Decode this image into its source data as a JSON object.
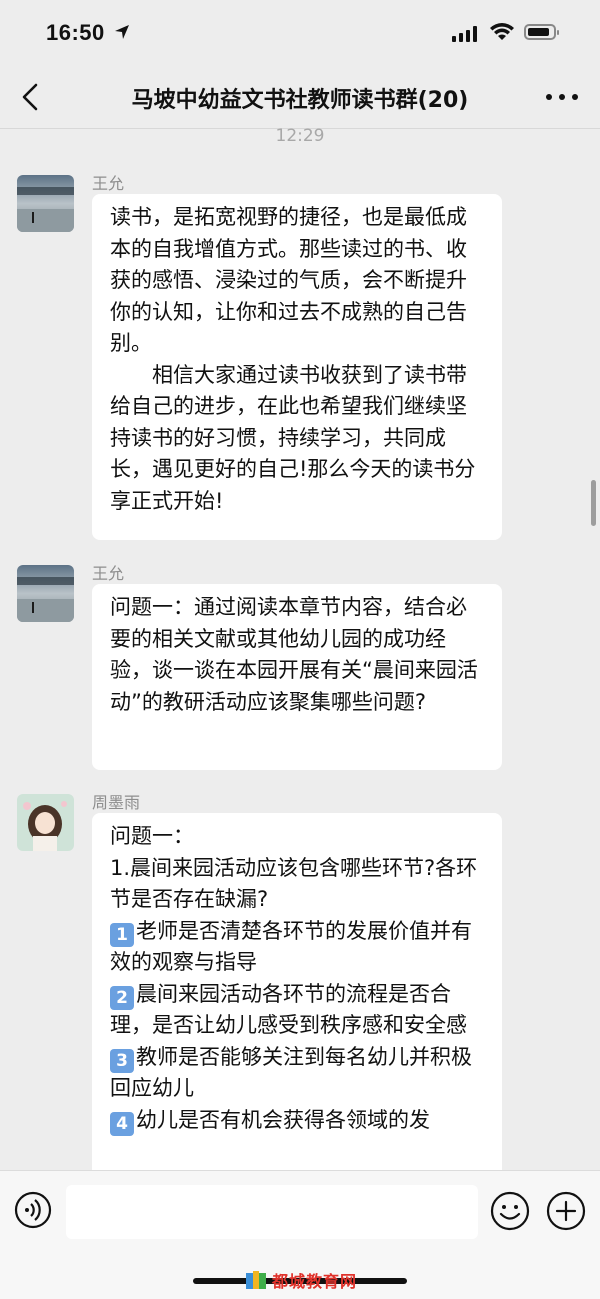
{
  "status_bar": {
    "time": "16:50"
  },
  "nav": {
    "title": "马坡中幼益文书社教师读书群(20)"
  },
  "timestamp": "12:29",
  "messages": [
    {
      "sender": "王允",
      "paragraphs": [
        "读书，是拓宽视野的捷径，也是最低成本的自我增值方式。那些读过的书、收获的感悟、浸染过的气质，会不断提升你的认知，让你和过去不成熟的自己告别。",
        "相信大家通过读书收获到了读书带给自己的进步，在此也希望我们继续坚持读书的好习惯，持续学习，共同成长，遇见更好的自己!那么今天的读书分享正式开始!"
      ]
    },
    {
      "sender": "王允",
      "paragraphs": [
        "问题一：通过阅读本章节内容，结合必要的相关文献或其他幼儿园的成功经验，谈一谈在本园开展有关“晨间来园活动”的教研活动应该聚集哪些问题?"
      ]
    },
    {
      "sender": "周墨雨",
      "lines": [
        "问题一：",
        "1.晨间来园活动应该包含哪些环节?各环节是否存在缺漏?"
      ],
      "items": [
        {
          "num": "1",
          "text": "老师是否清楚各环节的发展价值并有效的观察与指导"
        },
        {
          "num": "2",
          "text": "晨间来园活动各环节的流程是否合理，是否让幼儿感受到秩序感和安全感"
        },
        {
          "num": "3",
          "text": "教师是否能够关注到每名幼儿并积极回应幼儿"
        },
        {
          "num": "4",
          "text": "幼儿是否有机会获得各领域的发"
        }
      ]
    }
  ],
  "input": {
    "placeholder": ""
  },
  "watermark": {
    "text": "都城教育网"
  },
  "colors": {
    "background": "#ededed",
    "bubble": "#ffffff",
    "keycap": "#6aa0e0",
    "watermark": "#e0322b"
  }
}
